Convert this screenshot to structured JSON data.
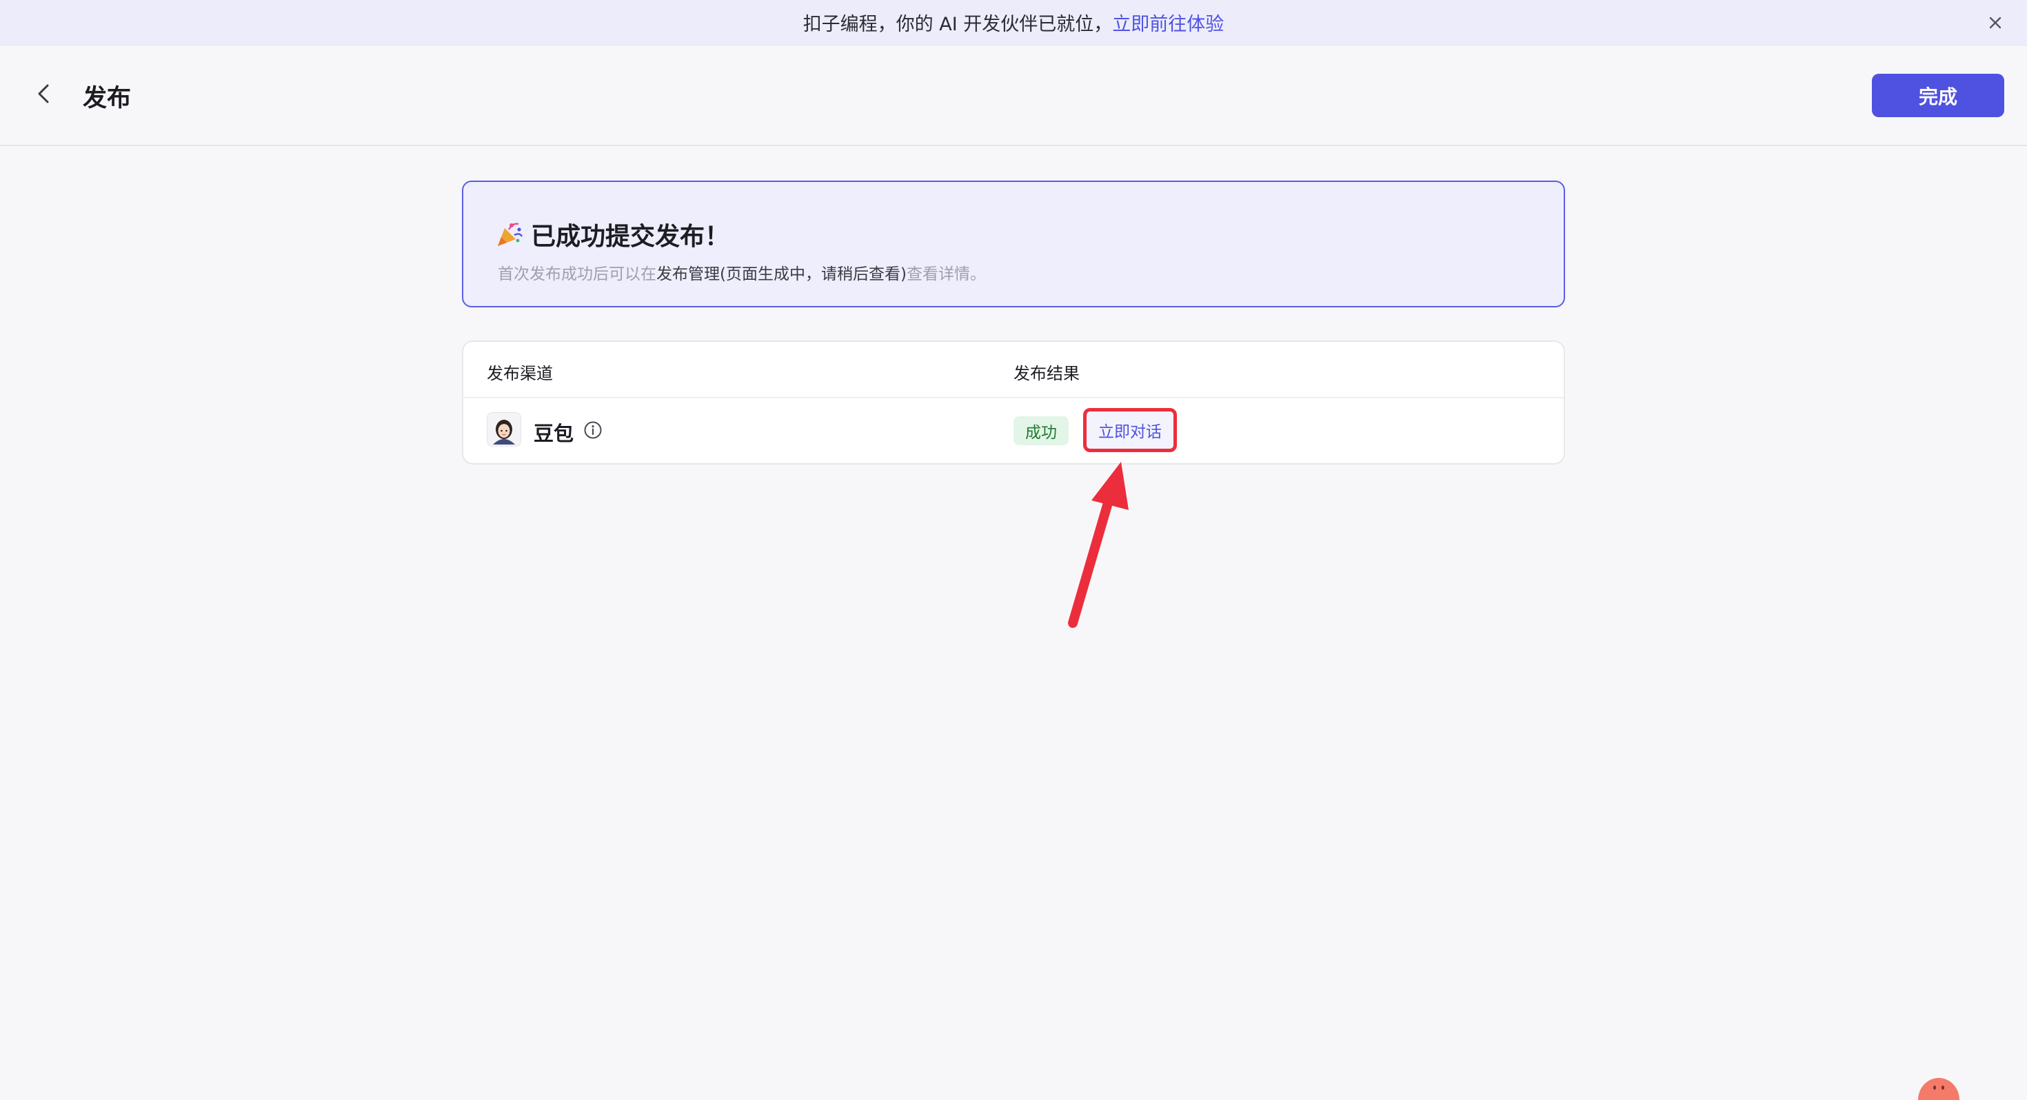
{
  "banner": {
    "text": "扣子编程，你的 AI 开发伙伴已就位，",
    "link": "立即前往体验"
  },
  "header": {
    "title": "发布",
    "done_label": "完成"
  },
  "success": {
    "title": "已成功提交发布！",
    "desc_prefix": "首次发布成功后可以在",
    "desc_highlight": "发布管理(页面生成中，请稍后查看)",
    "desc_link": "查看详情。"
  },
  "table": {
    "columns": [
      "发布渠道",
      "发布结果"
    ],
    "rows": [
      {
        "channel": "豆包",
        "status": "成功",
        "action": "立即对话"
      }
    ]
  },
  "colors": {
    "accent": "#4f52e0",
    "banner_bg": "#ececfb",
    "success_border": "#5a5de3",
    "status_green": "#1f7a33",
    "annotation_red": "#ec2e3c"
  },
  "icons": {
    "banner_close": "close-icon",
    "back": "chevron-left-icon",
    "success": "party-popper-icon",
    "channel": "doubao-avatar-icon",
    "info": "info-circle-icon",
    "annotation": "red-arrow-icon",
    "mascot": "mascot-icon"
  }
}
